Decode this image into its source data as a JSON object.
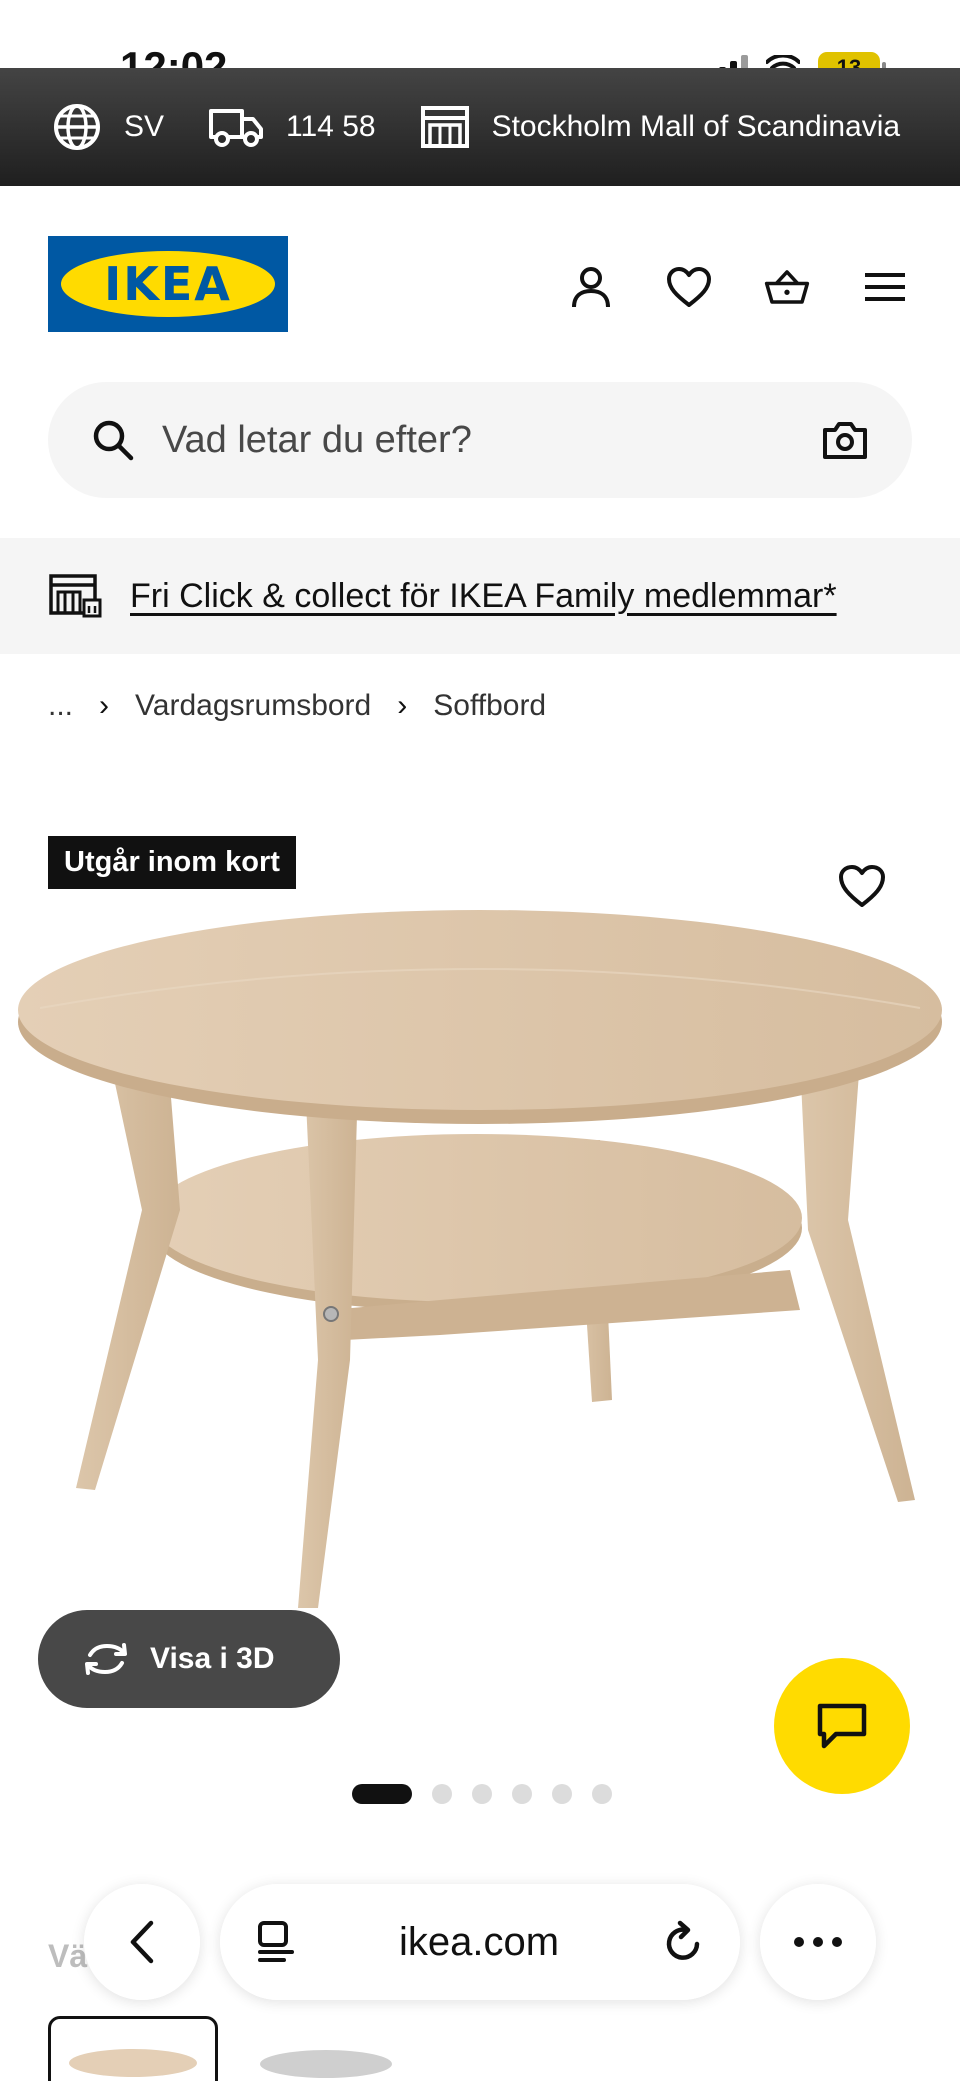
{
  "status_bar": {
    "time": "12:02",
    "battery": "13"
  },
  "top_strip": {
    "language": "SV",
    "postal_code": "114 58",
    "store": "Stockholm Mall of Scandinavia"
  },
  "header": {
    "logo_text": "IKEA",
    "icons": [
      "profile-icon",
      "heart-icon",
      "basket-icon",
      "menu-icon"
    ]
  },
  "search": {
    "placeholder": "Vad letar du efter?"
  },
  "banner": {
    "text": "Fri Click & collect för IKEA Family medlemmar*"
  },
  "breadcrumb": {
    "items": [
      "...",
      "Vardagsrumsbord",
      "Soffbord"
    ]
  },
  "product": {
    "tag": "Utgår inom kort",
    "view_3d_label": "Visa i 3D",
    "carousel": {
      "count": 6,
      "active_index": 0
    }
  },
  "bottom": {
    "label_partial": "Vä"
  },
  "browser": {
    "url": "ikea.com"
  },
  "colors": {
    "ikea_blue": "#0058a3",
    "ikea_yellow": "#ffdb00",
    "chat_yellow": "#ffdb00",
    "tag_bg": "#111111"
  }
}
